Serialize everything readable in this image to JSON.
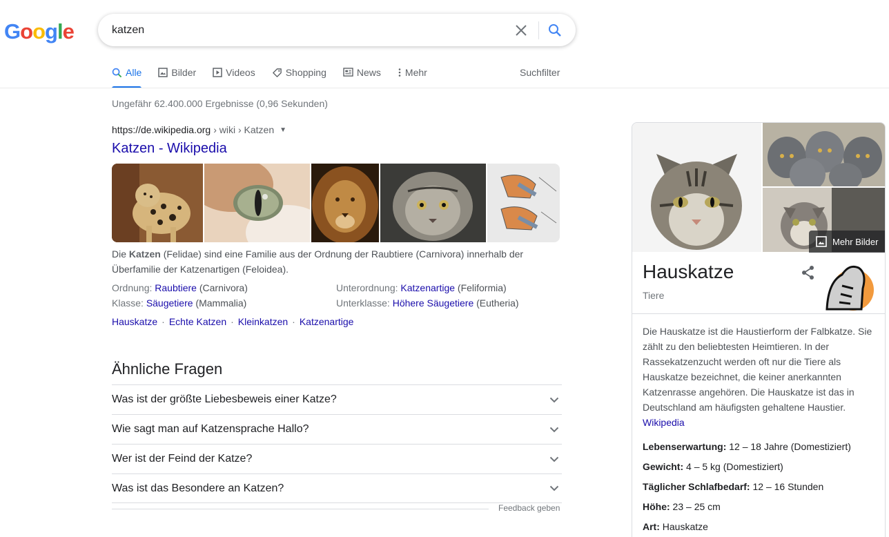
{
  "logo": {
    "letters": [
      "G",
      "o",
      "o",
      "g",
      "l",
      "e"
    ]
  },
  "search": {
    "query": "katzen"
  },
  "tabs": [
    {
      "label": "Alle",
      "icon": "search-icon"
    },
    {
      "label": "Bilder",
      "icon": "image-icon"
    },
    {
      "label": "Videos",
      "icon": "video-icon"
    },
    {
      "label": "Shopping",
      "icon": "tag-icon"
    },
    {
      "label": "News",
      "icon": "news-icon"
    },
    {
      "label": "Mehr",
      "icon": "more-vert-icon"
    }
  ],
  "suchfilter": "Suchfilter",
  "result_stats": "Ungefähr 62.400.000 Ergebnisse (0,96 Sekunden)",
  "result": {
    "domain": "https://de.wikipedia.org",
    "path": " › wiki › Katzen",
    "title": "Katzen - Wikipedia",
    "snippet_pre": "Die ",
    "snippet_bold": "Katzen",
    "snippet_post": " (Felidae) sind eine Familie aus der Ordnung der Raubtiere (Carnivora) innerhalb der Überfamilie der Katzenartigen (Feloidea).",
    "facts": [
      {
        "label": "Ordnung: ",
        "link": "Raubtiere",
        "value": " (Carnivora)"
      },
      {
        "label": "Unterordnung: ",
        "link": "Katzenartige",
        "value": " (Feliformia)"
      },
      {
        "label": "Klasse: ",
        "link": "Säugetiere",
        "value": " (Mammalia)"
      },
      {
        "label": "Unterklasse: ",
        "link": "Höhere Säugetiere",
        "value": " (Eutheria)"
      }
    ],
    "sitelinks": [
      "Hauskatze",
      "Echte Katzen",
      "Kleinkatzen",
      "Katzenartige"
    ]
  },
  "related": {
    "title": "Ähnliche Fragen",
    "questions": [
      "Was ist der größte Liebesbeweis einer Katze?",
      "Wie sagt man auf Katzensprache Hallo?",
      "Wer ist der Feind der Katze?",
      "Was ist das Besondere an Katzen?"
    ],
    "feedback": "Feedback geben"
  },
  "knowledge_panel": {
    "more_images": "Mehr Bilder",
    "title": "Hauskatze",
    "subtitle": "Tiere",
    "description": "Die Hauskatze ist die Haustierform der Falbkatze. Sie zählt zu den beliebtesten Heimtieren. In der Rassekatzenzucht werden oft nur die Tiere als Hauskatze bezeichnet, die keiner anerkannten Katzenrasse angehören. Die Hauskatze ist das in Deutschland am häufigsten gehaltene Haustier.",
    "source": "Wikipedia",
    "facts": [
      {
        "label": "Lebenserwartung:",
        "value": " 12 – 18 Jahre (Domestiziert)"
      },
      {
        "label": "Gewicht:",
        "value": " 4 – 5 kg (Domestiziert)"
      },
      {
        "label": "Täglicher Schlafbedarf:",
        "value": " 12 – 16 Stunden"
      },
      {
        "label": "Höhe:",
        "value": " 23 – 25 cm"
      },
      {
        "label": "Art:",
        "value": " Hauskatze"
      }
    ]
  },
  "colors": {
    "link": "#1a0dab",
    "accent": "#1a73e8",
    "google_blue": "#4285f4",
    "google_red": "#ea4335",
    "google_yellow": "#fbbc05",
    "google_green": "#34a853"
  }
}
